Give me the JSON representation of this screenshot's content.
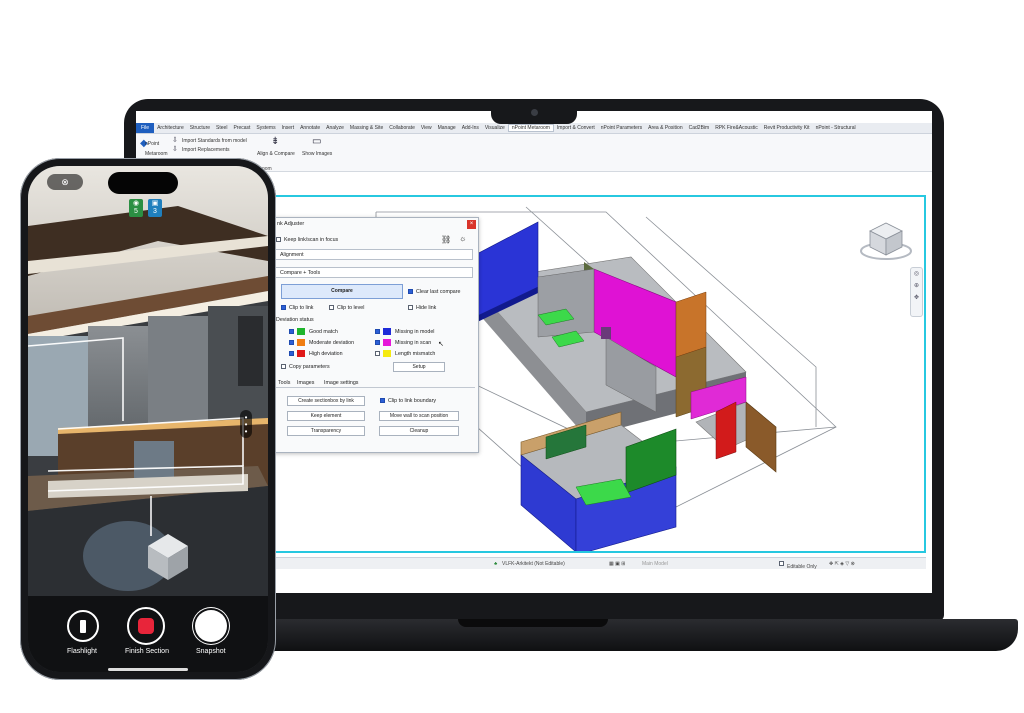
{
  "revit": {
    "tabs": [
      "File",
      "Architecture",
      "Structure",
      "Steel",
      "Precast",
      "Systems",
      "Insert",
      "Annotate",
      "Analyze",
      "Massing & Site",
      "Collaborate",
      "View",
      "Manage",
      "Add-Ins",
      "Visualize",
      "nPoint Metaroom",
      "Import & Convert",
      "nPoint Parameters",
      "Area & Position",
      "Cad2Bim",
      "RPK Fire&Acoustic",
      "Revit Productivity Kit",
      "nPoint - Structural"
    ],
    "active_tab": "nPoint Metaroom",
    "ribbon": {
      "npoint_label": "nPoint",
      "metaroom_label": "Metaroom",
      "import_standards": "Import Standards from model",
      "import_replacements": "Import Replacements",
      "align_compare": "Align & Compare",
      "show_images": "Show Images",
      "panel_label": "oom"
    },
    "status": {
      "workset": "VLFK-Arkitekt (Not Editable)",
      "main_model": "Main Model",
      "editable_only": "Editable Only"
    }
  },
  "dialog": {
    "title": "nk Adjuster",
    "keep_focus": "Keep link/scan in focus",
    "alignment": "Alignment",
    "compare_tools": "Compare + Tools",
    "compare_button": "Compare",
    "clear_last": "Clear last compare",
    "clip_link": "Clip to link",
    "clip_level": "Clip to level",
    "hide_link": "Hide link",
    "deviation_status": "Deviation status",
    "good_match": "Good match",
    "moderate_deviation": "Moderate deviation",
    "high_deviation": "High deviation",
    "missing_model": "Missing in model",
    "missing_scan": "Missing in scan",
    "length_mismatch": "Length mismatch",
    "copy_parameters": "Copy parameters",
    "setup": "Setup",
    "tab_tools": "Tools",
    "tab_images": "Images",
    "tab_image_settings": "Image settings",
    "create_sectionbox": "Create sectionbox by link",
    "clip_boundary": "Clip to link boundary",
    "keep_element": "Keep element",
    "move_wall": "Move wall to scan position",
    "transparency": "Transparency",
    "cleanup": "Cleanup",
    "colors": {
      "good": "#1fb52c",
      "moderate": "#f07d12",
      "high": "#e01818",
      "missing_model": "#1f2bd8",
      "missing_scan": "#e617d9",
      "length": "#f5ea10"
    }
  },
  "phone": {
    "close_icon": "x-circle-icon",
    "badge_eye_count": "5",
    "badge_box_count": "3",
    "controls": {
      "flashlight": "Flashlight",
      "finish_section": "Finish Section",
      "snapshot": "Snapshot"
    }
  }
}
